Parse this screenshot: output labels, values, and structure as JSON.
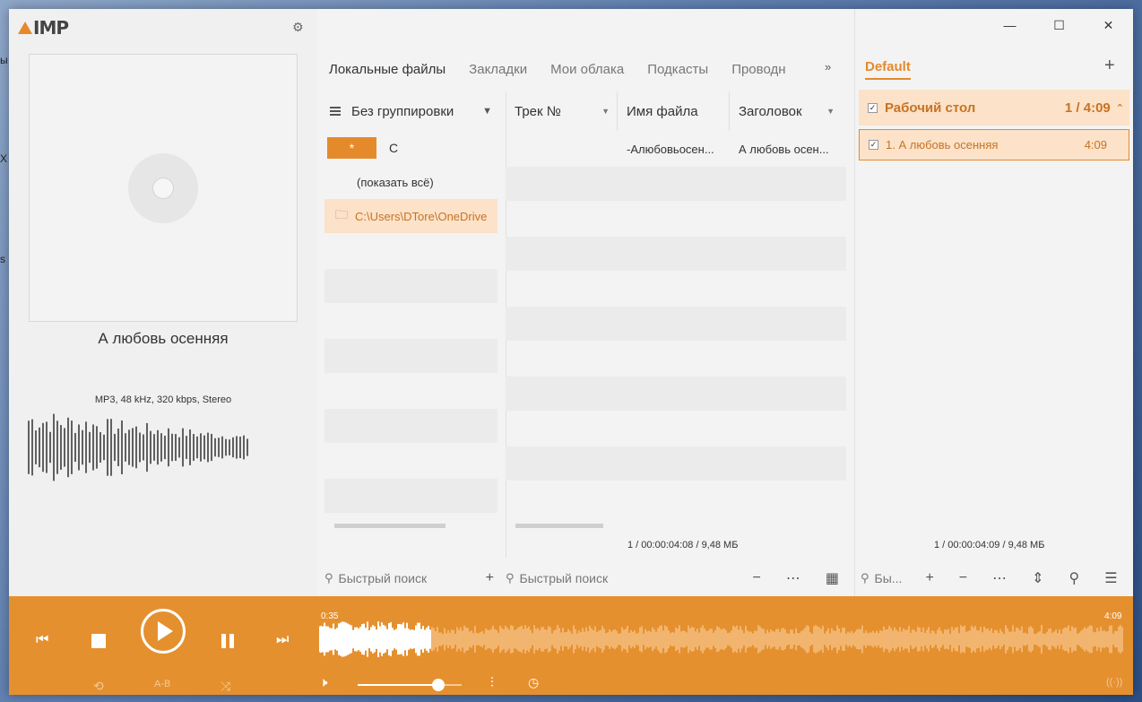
{
  "app": {
    "logo_text": "IMP",
    "settings_icon": "gear-icon"
  },
  "now_playing": {
    "title": "А любовь осенняя",
    "format_info": "MP3, 48 kHz, 320 kbps, Stereo"
  },
  "library": {
    "tabs": [
      {
        "label": "Локальные файлы",
        "active": true
      },
      {
        "label": "Закладки",
        "active": false
      },
      {
        "label": "Мои облака",
        "active": false
      },
      {
        "label": "Подкасты",
        "active": false
      },
      {
        "label": "Проводн",
        "active": false
      }
    ],
    "grouping_label": "Без группировки",
    "group_rows": {
      "star_label": "*",
      "letter": "С",
      "show_all": "(показать всё)",
      "folder_path": "C:\\Users\\DTore\\OneDrive"
    },
    "columns": [
      "Трек №",
      "Имя файла",
      "Заголовок"
    ],
    "tracks": [
      {
        "number": "",
        "filename": "-Алюбовьосен...",
        "title": "А любовь осен..."
      }
    ],
    "status": "1 / 00:00:04:08 / 9,48 МБ",
    "search_placeholder_left": "Быстрый поиск",
    "search_placeholder_mid": "Быстрый поиск"
  },
  "playlist": {
    "tab_label": "Default",
    "group_name": "Рабочий стол",
    "group_meta": "1 / 4:09",
    "items": [
      {
        "label": "1. А любовь осенняя",
        "duration": "4:09"
      }
    ],
    "status": "1 / 00:00:04:09 / 9,48 МБ",
    "search_placeholder": "Бы..."
  },
  "player": {
    "position": "0:35",
    "duration": "4:09",
    "progress": 0.14,
    "volume": 0.78,
    "ab_label": "A-B"
  },
  "colors": {
    "accent": "#e5902f",
    "highlight": "#fbe2c8",
    "accent_text": "#c87323"
  }
}
